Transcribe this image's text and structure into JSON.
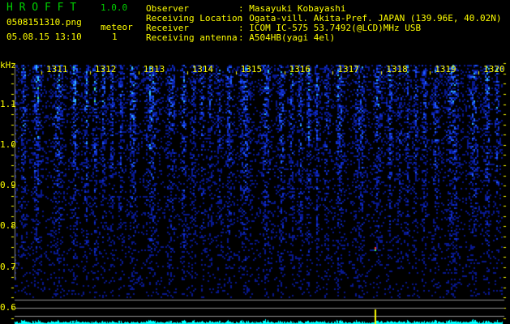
{
  "app": {
    "title": "H R O F F T",
    "version": "1.0.0"
  },
  "file": {
    "name": "0508151310.png",
    "datetime": "05.08.15 13:10"
  },
  "meteor": {
    "label": "meteor",
    "count": "1"
  },
  "info": [
    {
      "label": "Observer",
      "value": ": Masayuki Kobayashi"
    },
    {
      "label": "Receiving Location",
      "value": ": Ogata-vill. Akita-Pref. JAPAN (139.96E, 40.02N)"
    },
    {
      "label": "Receiver",
      "value": ": ICOM IC-575 53.7492(@LCD)MHz USB"
    },
    {
      "label": "Receiving antenna",
      "value": ": A504HB(yagi 4el)"
    }
  ],
  "axis": {
    "unit": "kHz",
    "y_ticks": [
      "1.1",
      "1.0",
      "0.9",
      "0.8",
      "0.7",
      "0.6"
    ],
    "time_labels": [
      "1311",
      "1312",
      "1313",
      "1314",
      "1315",
      "1316",
      "1317",
      "1318",
      "1319",
      "1320"
    ]
  },
  "colors": {
    "text": "#ffff00",
    "title": "#00d000",
    "trace": "#00ffff",
    "background": "#000000"
  }
}
